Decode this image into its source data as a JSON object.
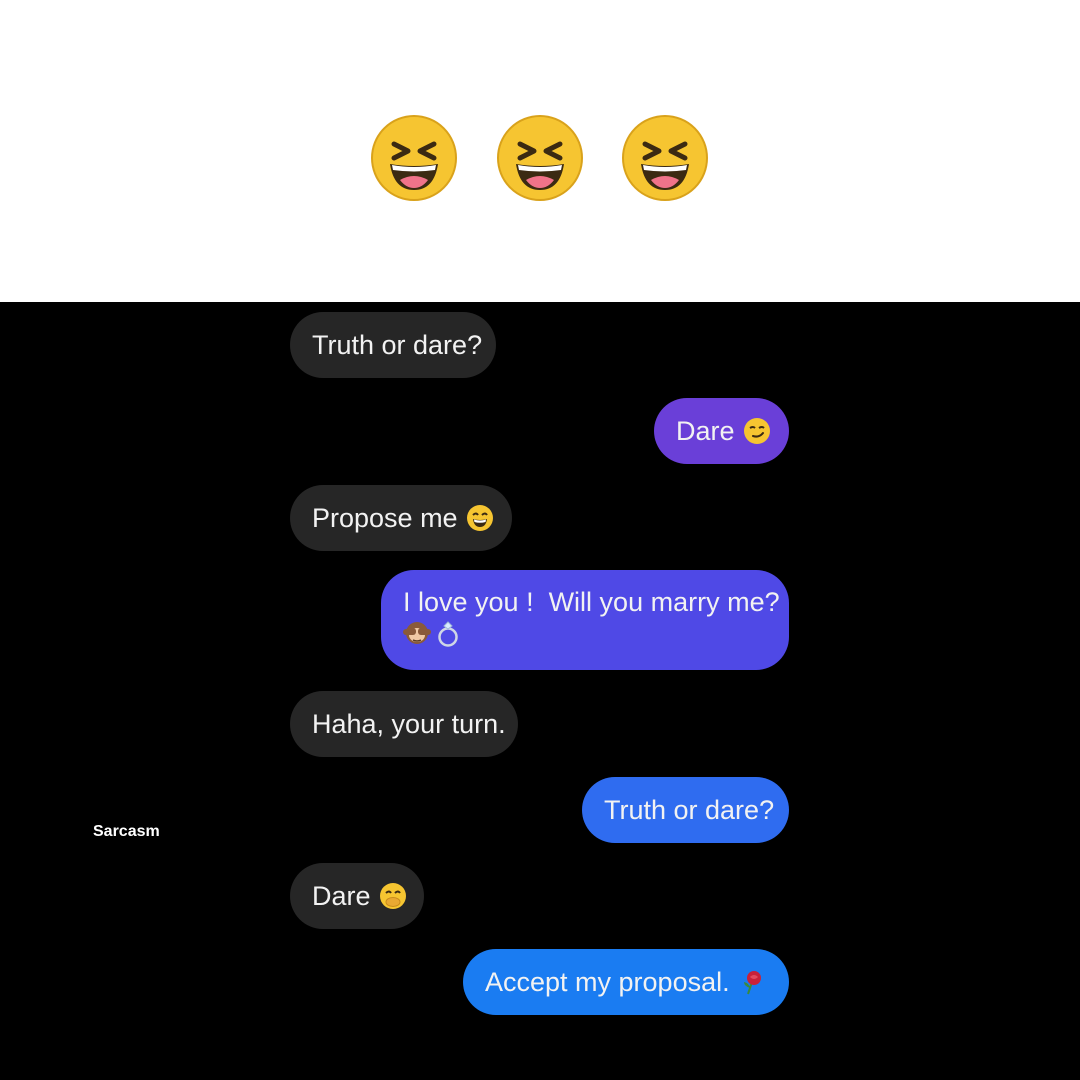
{
  "header": {
    "emojis": [
      "laughing-face-icon",
      "laughing-face-icon",
      "laughing-face-icon"
    ]
  },
  "conversation": {
    "messages": [
      {
        "side": "received",
        "text": "Truth or dare?",
        "emoji": ""
      },
      {
        "side": "sent",
        "text": "Dare",
        "emoji": "smirk-face-icon",
        "color": "#6a3fd8"
      },
      {
        "side": "received",
        "text": "Propose me",
        "emoji": "grinning-sweat-face-icon"
      },
      {
        "side": "sent",
        "text": "I love you !  Will you marry me?",
        "emoji": "see-no-evil-monkey-icon, ring-icon",
        "color": "#4f49e6"
      },
      {
        "side": "received",
        "text": "Haha, your turn.",
        "emoji": ""
      },
      {
        "side": "sent",
        "text": "Truth or dare?",
        "emoji": "",
        "color": "#2f6cf0"
      },
      {
        "side": "received",
        "text": "Dare",
        "emoji": "hand-over-mouth-face-icon"
      },
      {
        "side": "sent",
        "text": "Accept my proposal.",
        "emoji": "rose-icon",
        "color": "#1a7cf2"
      }
    ]
  },
  "watermark": "Sarcasm",
  "colors": {
    "received_bubble": "#262626",
    "background": "#000000",
    "top_background": "#ffffff"
  }
}
